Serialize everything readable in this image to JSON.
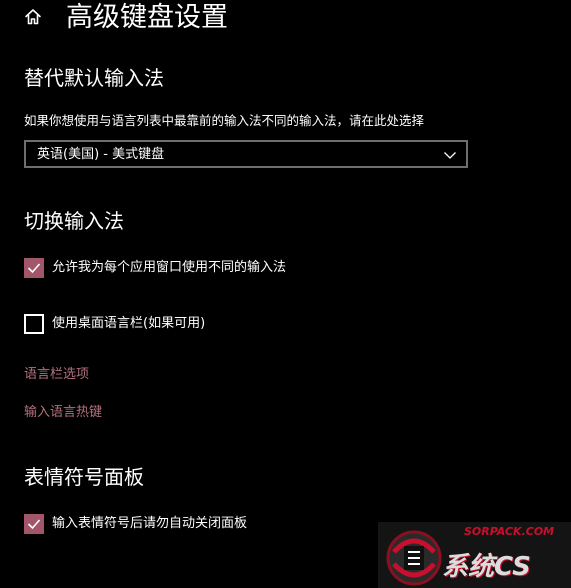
{
  "header": {
    "title": "高级键盘设置",
    "home_icon": "home-icon"
  },
  "override_section": {
    "title": "替代默认输入法",
    "description": "如果你想使用与语言列表中最靠前的输入法不同的输入法，请在此处选择",
    "dropdown_value": "英语(美国) - 美式键盘"
  },
  "switch_section": {
    "title": "切换输入法",
    "option_per_app": {
      "label": "允许我为每个应用窗口使用不同的输入法",
      "checked": true
    },
    "option_desktop_bar": {
      "label": "使用桌面语言栏(如果可用)",
      "checked": false
    },
    "link_langbar_options": "语言栏选项",
    "link_hotkeys": "输入语言热键"
  },
  "emoji_section": {
    "title": "表情符号面板",
    "option_close_panel": {
      "label": "输入表情符号后请勿自动关闭面板",
      "checked": true
    }
  },
  "watermark": {
    "site": "SORPACK.COM",
    "brand": "系统CS"
  },
  "colors": {
    "background": "#000000",
    "accent": "#a3566a",
    "link": "#b5707f",
    "border": "#6e6e6e",
    "text": "#ffffff"
  }
}
